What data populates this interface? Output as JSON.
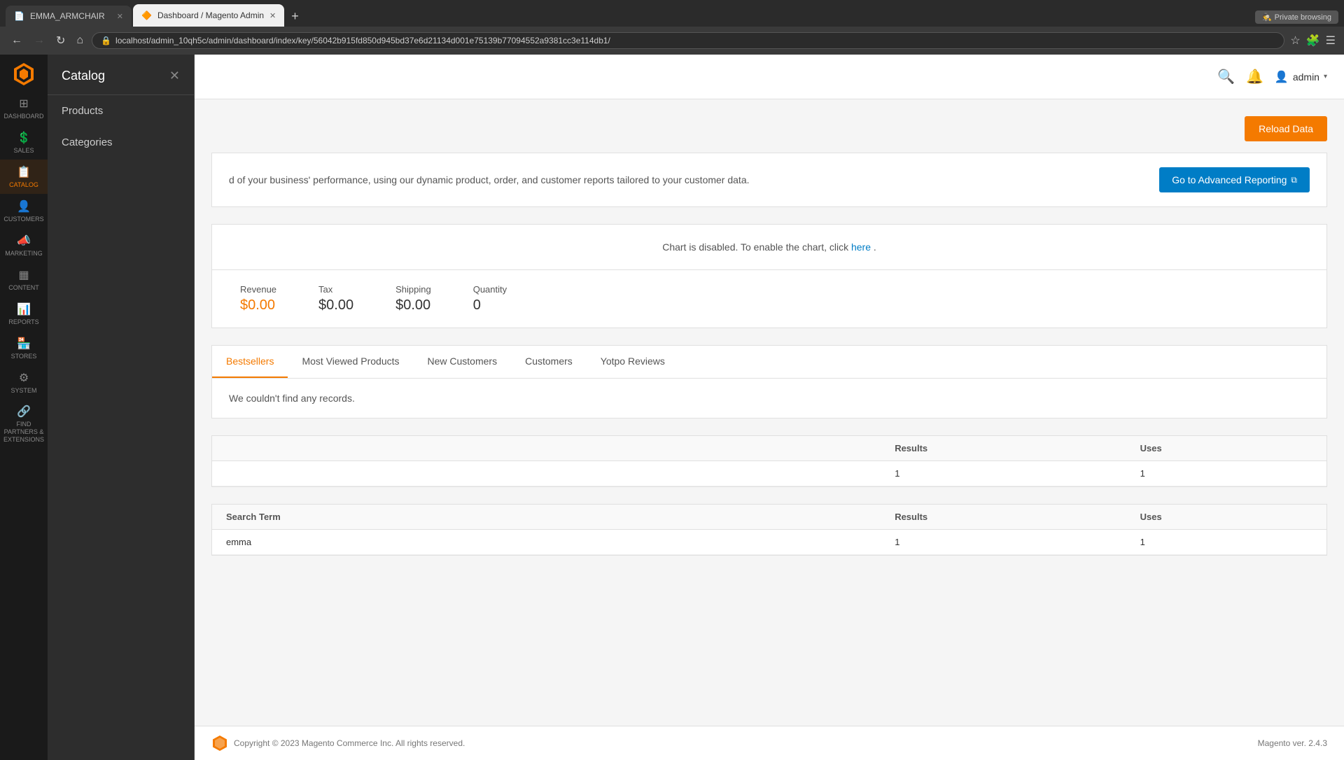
{
  "browser": {
    "tabs": [
      {
        "id": "tab1",
        "title": "EMMA_ARMCHAIR",
        "active": false,
        "favicon": "📄"
      },
      {
        "id": "tab2",
        "title": "Dashboard / Magento Admin",
        "active": true,
        "favicon": "🔶"
      }
    ],
    "new_tab_label": "+",
    "private_browsing_label": "Private browsing",
    "address": "localhost/admin_10qh5c/admin/dashboard/index/key/56042b915fd850d945bd37e6d21134d001e75139b77094552a9381cc3e114db1/",
    "nav_back": "←",
    "nav_forward": "→",
    "nav_refresh": "↻",
    "nav_home": "⌂"
  },
  "sidebar": {
    "items": [
      {
        "id": "dashboard",
        "label": "DASHBOARD",
        "icon": "⊞"
      },
      {
        "id": "sales",
        "label": "SALES",
        "icon": "💲"
      },
      {
        "id": "catalog",
        "label": "CATALOG",
        "icon": "📋",
        "active": true
      },
      {
        "id": "customers",
        "label": "CUSTOMERS",
        "icon": "👤"
      },
      {
        "id": "marketing",
        "label": "MARKETING",
        "icon": "📣"
      },
      {
        "id": "content",
        "label": "CONTENT",
        "icon": "▦"
      },
      {
        "id": "reports",
        "label": "REPORTS",
        "icon": "📊"
      },
      {
        "id": "stores",
        "label": "STORES",
        "icon": "🏪"
      },
      {
        "id": "system",
        "label": "SYSTEM",
        "icon": "⚙"
      },
      {
        "id": "partners",
        "label": "FIND PARTNERS & EXTENSIONS",
        "icon": "🔗"
      }
    ]
  },
  "flyout": {
    "title": "Catalog",
    "close_icon": "✕",
    "menu_items": [
      {
        "id": "products",
        "label": "Products"
      },
      {
        "id": "categories",
        "label": "Categories"
      }
    ]
  },
  "header": {
    "search_icon": "🔍",
    "notification_icon": "🔔",
    "admin_label": "admin",
    "admin_arrow": "▾"
  },
  "page": {
    "reload_button": "Reload Data",
    "advanced_reporting": {
      "text": "d of your business' performance, using our dynamic product, order, and customer reports tailored to your customer data.",
      "button_label": "Go to Advanced Reporting",
      "ext_icon": "⧉"
    },
    "chart_disabled_text": "Chart is disabled. To enable the chart, click ",
    "chart_disabled_link": "here",
    "stats": [
      {
        "label": "Revenue",
        "value": "$0.00",
        "orange": true
      },
      {
        "label": "Tax",
        "value": "$0.00",
        "orange": false
      },
      {
        "label": "Shipping",
        "value": "$0.00",
        "orange": false
      },
      {
        "label": "Quantity",
        "value": "0",
        "orange": false
      }
    ],
    "tabs": [
      {
        "id": "bestsellers",
        "label": "Bestsellers",
        "active": true
      },
      {
        "id": "most-viewed",
        "label": "Most Viewed Products",
        "active": false
      },
      {
        "id": "new-customers",
        "label": "New Customers",
        "active": false
      },
      {
        "id": "customers",
        "label": "Customers",
        "active": false
      },
      {
        "id": "yotpo",
        "label": "Yotpo Reviews",
        "active": false
      }
    ],
    "tab_content_message": "We couldn't find any records.",
    "search_tables": [
      {
        "id": "table1",
        "columns": [
          "Results",
          "Uses"
        ],
        "rows": [
          {
            "search_term": "",
            "results": "1",
            "uses": "1"
          }
        ]
      },
      {
        "id": "table2",
        "header": "Search Term",
        "columns": [
          "Results",
          "Uses"
        ],
        "rows": [
          {
            "search_term": "emma",
            "results": "1",
            "uses": "1"
          }
        ]
      }
    ]
  },
  "footer": {
    "copyright": "Copyright © 2023 Magento Commerce Inc. All rights reserved.",
    "version": "Magento ver. 2.4.3"
  }
}
